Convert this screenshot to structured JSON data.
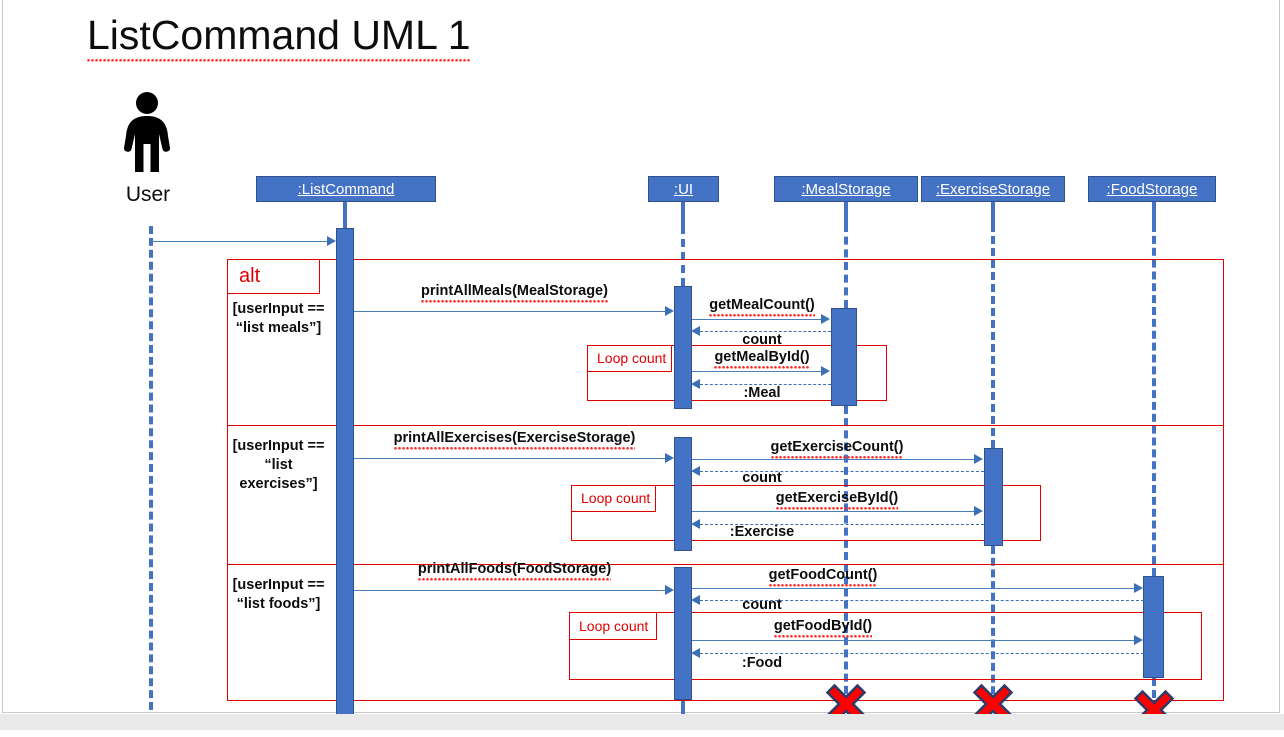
{
  "slide": {
    "title": "ListCommand UML 1"
  },
  "actor": {
    "name": "User",
    "icon": "person-icon"
  },
  "lifelines": [
    {
      "id": "listcommand",
      "label": ":ListCommand"
    },
    {
      "id": "ui",
      "label": ":UI"
    },
    {
      "id": "mealstorage",
      "label": ":MealStorage"
    },
    {
      "id": "exercisestorage",
      "label": ":ExerciseStorage"
    },
    {
      "id": "foodstorage",
      "label": ":FoodStorage"
    }
  ],
  "fragment": {
    "type": "alt",
    "label": "alt",
    "loop_label": "Loop count",
    "branches": [
      {
        "guard": "[userInput == “list meals”]",
        "call": "printAllMeals(MealStorage)",
        "messages": [
          {
            "label": "getMealCount()",
            "kind": "call"
          },
          {
            "label": "count",
            "kind": "return"
          },
          {
            "label": "getMealById()",
            "kind": "call"
          },
          {
            "label": ":Meal",
            "kind": "return"
          }
        ]
      },
      {
        "guard": "[userInput == “list exercises”]",
        "call": "printAllExercises(ExerciseStorage)",
        "messages": [
          {
            "label": "getExerciseCount()",
            "kind": "call"
          },
          {
            "label": "count",
            "kind": "return"
          },
          {
            "label": "getExerciseById()",
            "kind": "call"
          },
          {
            "label": ":Exercise",
            "kind": "return"
          }
        ]
      },
      {
        "guard": "[userInput == “list foods”]",
        "call": "printAllFoods(FoodStorage)",
        "messages": [
          {
            "label": "getFoodCount()",
            "kind": "call"
          },
          {
            "label": "count",
            "kind": "return"
          },
          {
            "label": "getFoodById()",
            "kind": "call"
          },
          {
            "label": ":Food",
            "kind": "return"
          }
        ]
      }
    ]
  },
  "destruction": [
    {
      "target": ":MealStorage"
    },
    {
      "target": ":ExerciseStorage"
    },
    {
      "target": ":FoodStorage"
    }
  ],
  "colors": {
    "lifeline_fill": "#4472C4",
    "lifeline_border": "#2F528F",
    "fragment_border": "#E00000",
    "message_arrow": "#4A7EBB",
    "destruction_x": "#FF0000",
    "title_text": "#0D0D0D"
  }
}
